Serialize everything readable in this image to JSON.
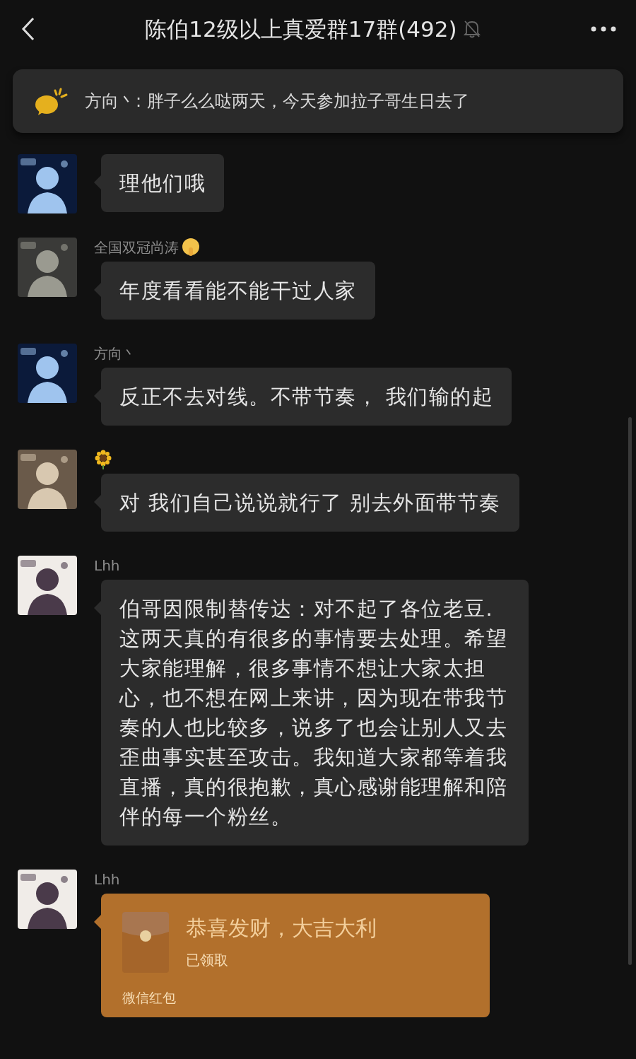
{
  "header": {
    "title": "陈伯12级以上真爱群17群(492)",
    "muted": true
  },
  "notice": {
    "text": "方向丶: 胖子么么哒两天，今天参加拉子哥生日去了"
  },
  "messages": [
    {
      "kind": "text",
      "text": "理他们哦"
    },
    {
      "kind": "text",
      "sender": "全国双冠尚涛",
      "sender_icon": {
        "kind": "shush"
      },
      "text": "年度看看能不能干过人家"
    },
    {
      "kind": "text",
      "sender": "方向丶",
      "text": "反正不去对线。不带节奏， 我们输的起"
    },
    {
      "kind": "text",
      "sender_icon": {
        "kind": "sunflower"
      },
      "text": "对  我们自己说说就行了 别去外面带节奏"
    },
    {
      "kind": "text",
      "sender": "Lhh",
      "text": "伯哥因限制替传达：对不起了各位老豆.这两天真的有很多的事情要去处理。希望大家能理解，很多事情不想让大家太担心，也不想在网上来讲，因为现在带我节奏的人也比较多，说多了也会让别人又去歪曲事实甚至攻击。我知道大家都等着我直播，真的很抱歉，真心感谢能理解和陪伴的每一个粉丝。"
    },
    {
      "kind": "red_packet",
      "sender": "Lhh",
      "text": "恭喜发财，大吉大利",
      "status": "已领取",
      "footer": "微信红包"
    }
  ]
}
